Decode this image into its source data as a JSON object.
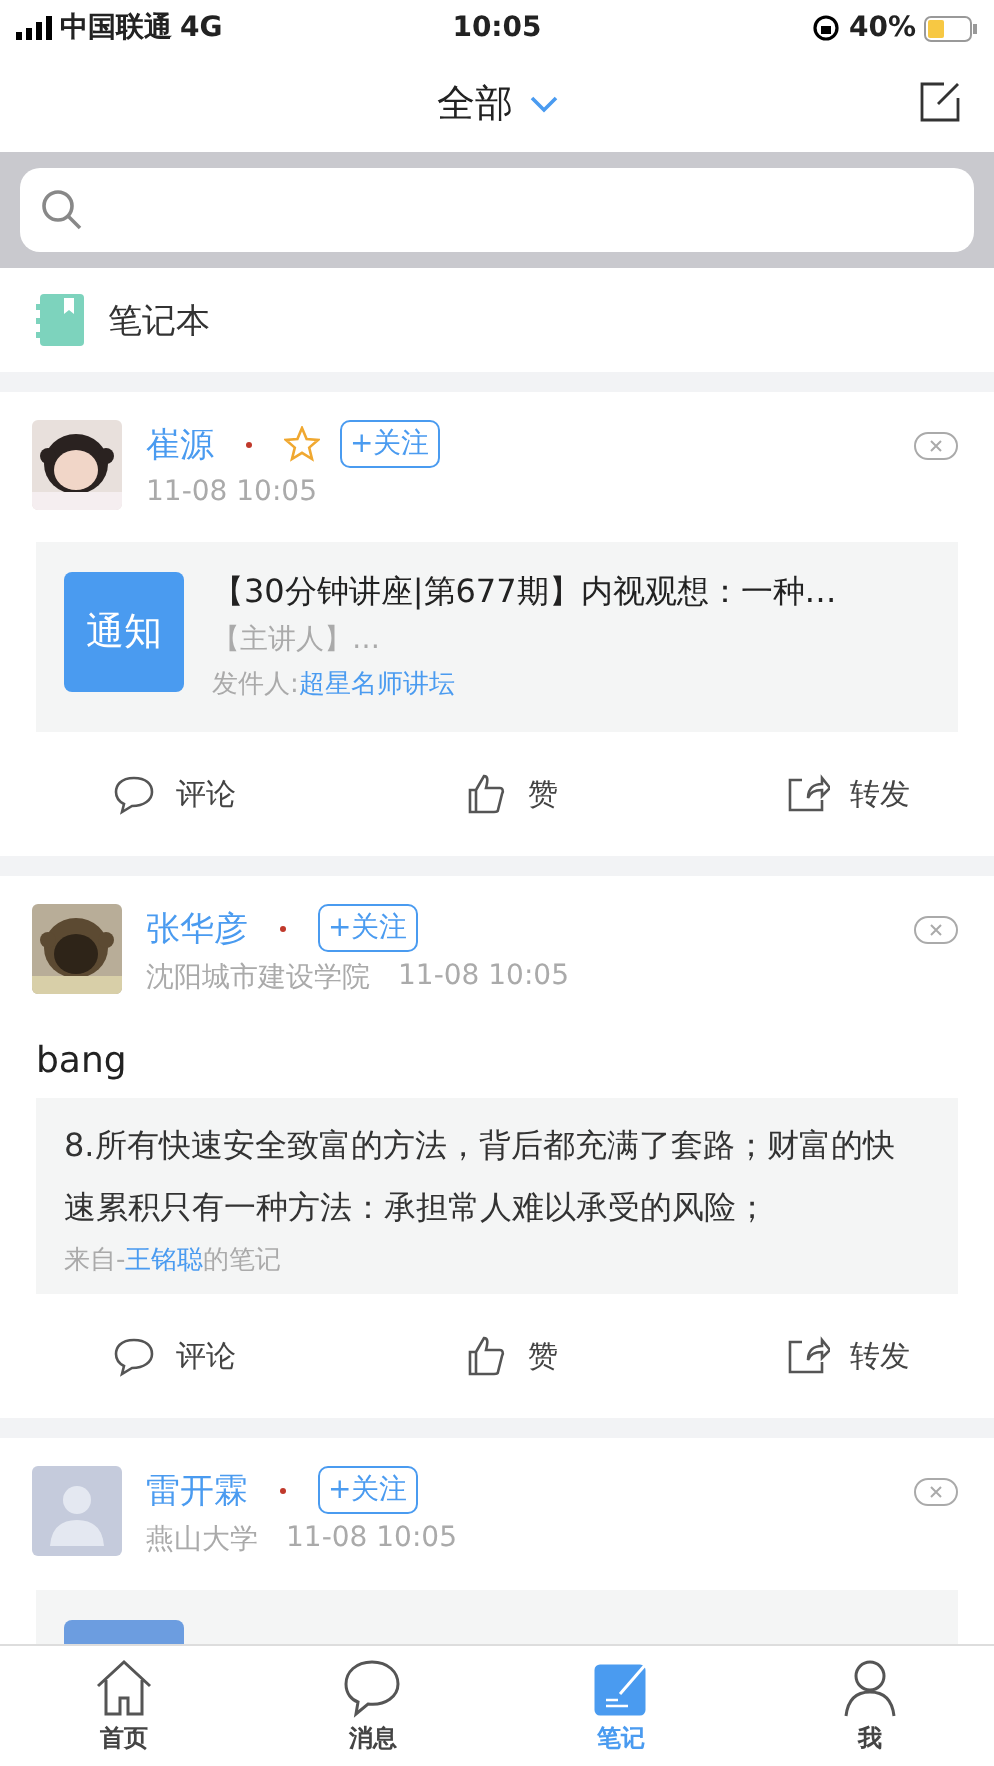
{
  "status_bar": {
    "carrier": "中国联通",
    "network": "4G",
    "time": "10:05",
    "battery": "40%"
  },
  "nav": {
    "title": "全部"
  },
  "notebook": {
    "label": "笔记本"
  },
  "posts": [
    {
      "avatar": {
        "kind": "picture"
      },
      "name": "崔源",
      "starred": true,
      "follow": "+关注",
      "time": "11-08 10:05",
      "attachment": {
        "kind": "notice",
        "badge": "通知",
        "title": "【30分钟讲座|第677期】内视观想：一种…",
        "subtitle": "【主讲人】…",
        "sender_label": "发件人:",
        "sender": "超星名师讲坛"
      },
      "actions": [
        "评论",
        "赞",
        "转发"
      ]
    },
    {
      "avatar": {
        "kind": "picture"
      },
      "name": "张华彦",
      "starred": false,
      "follow": "+关注",
      "org": "沈阳城市建设学院",
      "time": "11-08 10:05",
      "body": "bang",
      "attachment": {
        "kind": "quote",
        "text": "8.所有快速安全致富的方法，背后都充满了套路；财富的快速累积只有一种方法：承担常人难以承受的风险；",
        "source_prefix": "来自-",
        "source_name": "王铭聪",
        "source_suffix": "的笔记"
      },
      "actions": [
        "评论",
        "赞",
        "转发"
      ]
    },
    {
      "avatar": {
        "kind": "default"
      },
      "name": "雷开霖",
      "starred": false,
      "follow": "+关注",
      "org": "燕山大学",
      "time": "11-08 10:05",
      "attachment": {
        "kind": "file"
      }
    }
  ],
  "tabs": [
    {
      "label": "首页",
      "selected": false
    },
    {
      "label": "消息",
      "selected": false
    },
    {
      "label": "笔记",
      "selected": true
    },
    {
      "label": "我",
      "selected": false
    }
  ]
}
